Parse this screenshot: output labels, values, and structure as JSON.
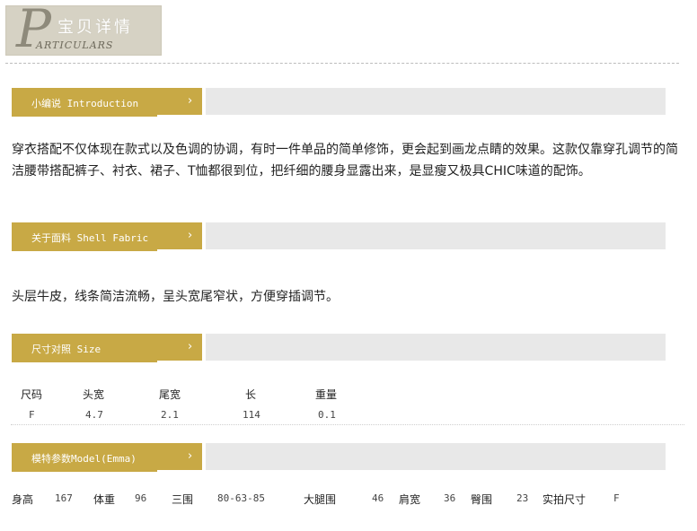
{
  "logo": {
    "big_letter": "P",
    "cn_text": "宝贝详情",
    "en_text": "ARTICULARS"
  },
  "sections": {
    "intro": {
      "title": "小编说 Introduction",
      "chevron": "›",
      "text": " 穿衣搭配不仅体现在款式以及色调的协调，有时一件单品的简单修饰，更会起到画龙点睛的效果。这款仅靠穿孔调节的简洁腰带搭配裤子、衬衣、裙子、T恤都很到位，把纤细的腰身显露出来，是显瘦又极具CHIC味道的配饰。"
    },
    "fabric": {
      "title": "关于面料 Shell Fabric",
      "chevron": "›",
      "text": "头层牛皮，线条简洁流畅，呈头宽尾窄状，方便穿插调节。"
    },
    "size": {
      "title": "尺寸对照 Size",
      "chevron": "›",
      "headers": [
        "尺码",
        "头宽",
        "尾宽",
        "长",
        "重量"
      ],
      "row": [
        "F",
        "4.7",
        "2.1",
        "114",
        "0.1"
      ]
    },
    "model": {
      "title": "模特参数Model(Emma)",
      "chevron": "›",
      "params": [
        {
          "label": "身高",
          "value": "167"
        },
        {
          "label": "体重",
          "value": "96"
        },
        {
          "label": "三围",
          "value": "80-63-85"
        },
        {
          "label": "大腿围",
          "value": "46"
        },
        {
          "label": "肩宽",
          "value": "36"
        },
        {
          "label": "臀围",
          "value": "23"
        },
        {
          "label": "实拍尺寸",
          "value": "F"
        }
      ]
    }
  },
  "colors": {
    "accent_gold": "#c8a945",
    "bar_gray": "#e8e8e8",
    "logo_bg": "#d6d2c4"
  }
}
